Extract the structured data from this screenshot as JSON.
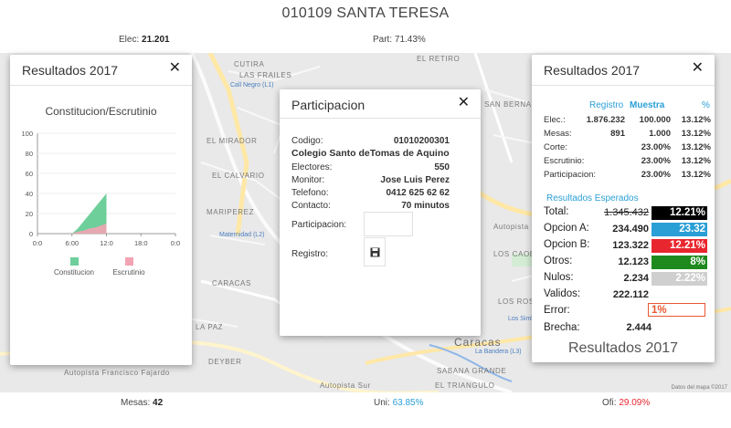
{
  "header": {
    "title": "010109 SANTA TERESA",
    "elec_label": "Elec:",
    "elec_value": "21.201",
    "part_label": "Part:",
    "part_value": "71.43%"
  },
  "footer": {
    "mesas_label": "Mesas:",
    "mesas_value": "42",
    "uni_label": "Uni:",
    "uni_value": "63.85%",
    "ofi_label": "Ofi:",
    "ofi_value": "29.09%",
    "colors": {
      "uni": "#2a9fd6",
      "ofi": "#e8262e"
    }
  },
  "map": {
    "labels": [
      "CUTIRA",
      "EL RETIRO",
      "LAS FRAILES",
      "SAN BERNARDINO",
      "EL MIRADOR",
      "EL CALVARIO",
      "MARIPEREZ",
      "LOS CAOBOS",
      "LOS ROSALES",
      "LA PAZ",
      "DEYBER",
      "EL TRIANGULO",
      "SABANA GRANDE",
      "CARACAS",
      "Caracas",
      "Autopista El Valle",
      "Autopista Francisco Fajardo",
      "Autopista Sur",
      "Call Negro (L1)",
      "Maternidad (L2)",
      "La Bandera (L3)",
      "Los Simbolos"
    ],
    "credit": "Datos del mapa ©2017"
  },
  "left_panel": {
    "title": "Resultados 2017",
    "close_icon": "close-icon",
    "chart_title": "Constitucion/Escrutinio",
    "legend": [
      {
        "label": "Constitucion",
        "color": "#6ecf9a"
      },
      {
        "label": "Escrutinio",
        "color": "#f3a3b3"
      }
    ]
  },
  "center_panel": {
    "title": "Participacion",
    "close_icon": "close-icon",
    "fields": [
      {
        "label": "Codigo:",
        "value": "01010200301"
      },
      {
        "label": "Colegio Santo deTomas de Aquino",
        "value": ""
      },
      {
        "label": "Electores:",
        "value": "550"
      },
      {
        "label": "Monitor:",
        "value": "Jose Luis Perez"
      },
      {
        "label": "Telefono:",
        "value": "0412 625 62 62"
      },
      {
        "label": "Contacto:",
        "value": "70 minutos"
      }
    ],
    "participacion_label": "Participacion:",
    "participacion_value": "",
    "registro_label": "Registro:",
    "save_icon": "floppy-disk-icon"
  },
  "right_panel": {
    "title": "Resultados 2017",
    "close_icon": "close-icon",
    "columns": {
      "registro": "Registro",
      "muestra": "Muestra",
      "pct": "%"
    },
    "rows": [
      {
        "label": "Elec.:",
        "registro": "1.876.232",
        "muestra": "100.000",
        "pct": "13.12%"
      },
      {
        "label": "Mesas:",
        "registro": "891",
        "muestra": "1.000",
        "pct": "13.12%"
      },
      {
        "label": "Corte:",
        "registro": "",
        "muestra": "23.00%",
        "pct": "13.12%"
      },
      {
        "label": "Escrutinio:",
        "registro": "",
        "muestra": "23.00%",
        "pct": "13.12%"
      },
      {
        "label": "Participacion:",
        "registro": "",
        "muestra": "23.00%",
        "pct": "13.12%"
      }
    ],
    "esperados_title": "Resultados Esperados",
    "esperados": [
      {
        "label": "Total:",
        "value": "1.345.432",
        "pct": "12.21%",
        "bg": "#000000",
        "fg": "#ffffff",
        "strike": true
      },
      {
        "label": "Opcion A:",
        "value": "234.490",
        "pct": "23.32",
        "bg": "#2a9fd6",
        "fg": "#ffffff",
        "strike": false
      },
      {
        "label": "Opcion B:",
        "value": "123.322",
        "pct": "12.21%",
        "bg": "#e8262e",
        "fg": "#ffffff",
        "strike": false
      },
      {
        "label": "Otros:",
        "value": "12.123",
        "pct": "8%",
        "bg": "#1e8a1e",
        "fg": "#ffffff",
        "strike": false
      },
      {
        "label": "Nulos:",
        "value": "2.234",
        "pct": "2.22%",
        "bg": "#cfcfcf",
        "fg": "#ffffff",
        "strike": false
      },
      {
        "label": "Validos:",
        "value": "222.112",
        "pct": "",
        "bg": "",
        "fg": "",
        "strike": false
      }
    ],
    "error_label": "Error:",
    "error_value": "1%",
    "error_color": "#e8572e",
    "brecha_label": "Brecha:",
    "brecha_value": "2.444",
    "footer_title": "Resultados 2017"
  },
  "chart_data": {
    "type": "area",
    "title": "Constitucion/Escrutinio",
    "x_ticks": [
      "0:0",
      "6:00",
      "12:0",
      "18:0",
      "0:0"
    ],
    "y_ticks": [
      0,
      20,
      40,
      60,
      80,
      100
    ],
    "ylim": [
      0,
      100
    ],
    "x_hours": [
      6,
      7,
      8,
      9,
      10,
      11,
      12
    ],
    "series": [
      {
        "name": "Constitucion",
        "color": "#6ecf9a",
        "values": [
          0,
          5,
          12,
          19,
          26,
          33,
          40
        ]
      },
      {
        "name": "Escrutinio",
        "color": "#f3a3b3",
        "values": [
          0,
          2,
          3,
          5,
          6,
          8,
          10
        ]
      }
    ]
  }
}
